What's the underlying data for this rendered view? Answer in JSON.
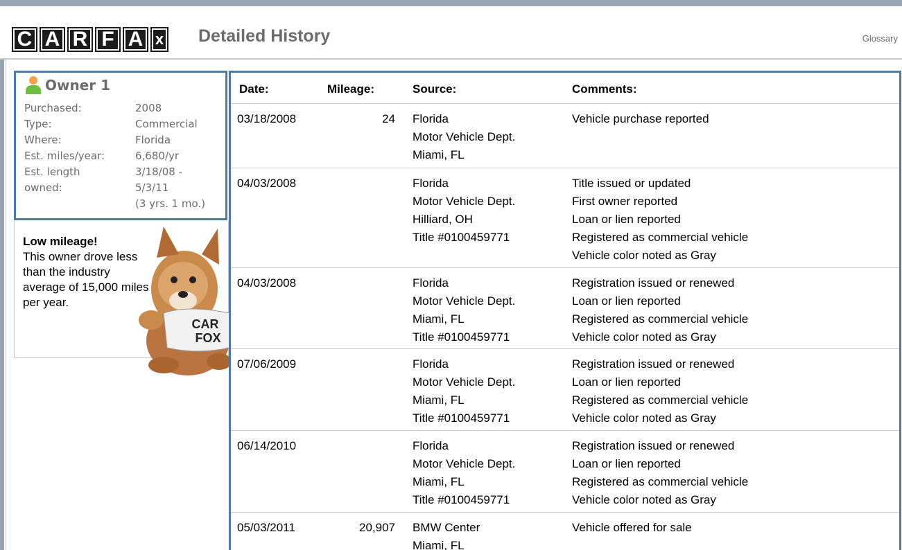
{
  "header": {
    "logo_letters": [
      "C",
      "A",
      "R",
      "F",
      "A",
      "x"
    ],
    "title": "Detailed History",
    "glossary_link": "Glossary"
  },
  "owner": {
    "title": "Owner 1",
    "icon": "person-icon",
    "details": [
      {
        "label": "Purchased:",
        "value": "2008"
      },
      {
        "label": "Type:",
        "value": "Commercial"
      },
      {
        "label": "Where:",
        "value": "Florida"
      },
      {
        "label": "Est. miles/year:",
        "value": "6,680/yr"
      }
    ],
    "length": {
      "label_lines": [
        "Est. length",
        "owned:"
      ],
      "value_lines": [
        "3/18/08 -",
        "5/3/11",
        "(3 yrs. 1 mo.)"
      ]
    },
    "note": {
      "heading": "Low mileage!",
      "text": "This owner drove less than the industry average of 15,000 miles per year."
    },
    "mascot_shirt_text": [
      "CAR",
      "FOX"
    ]
  },
  "table": {
    "headers": {
      "date": "Date:",
      "mileage": "Mileage:",
      "source": "Source:",
      "comments": "Comments:"
    },
    "rows": [
      {
        "date": "03/18/2008",
        "mileage": "24",
        "source": [
          "Florida",
          "Motor Vehicle Dept.",
          "Miami, FL"
        ],
        "comments": [
          "Vehicle purchase reported"
        ]
      },
      {
        "date": "04/03/2008",
        "mileage": "",
        "source": [
          "Florida",
          "Motor Vehicle Dept.",
          "Hilliard, OH",
          "Title #0100459771"
        ],
        "comments": [
          "Title issued or updated",
          "First owner reported",
          "Loan or lien reported",
          "Registered as commercial vehicle",
          "Vehicle color noted as Gray"
        ]
      },
      {
        "date": "04/03/2008",
        "mileage": "",
        "source": [
          "Florida",
          "Motor Vehicle Dept.",
          "Miami, FL",
          "Title #0100459771"
        ],
        "comments": [
          "Registration issued or renewed",
          "Loan or lien reported",
          "Registered as commercial vehicle",
          "Vehicle color noted as Gray"
        ]
      },
      {
        "date": "07/06/2009",
        "mileage": "",
        "source": [
          "Florida",
          "Motor Vehicle Dept.",
          "Miami, FL",
          "Title #0100459771"
        ],
        "comments": [
          "Registration issued or renewed",
          "Loan or lien reported",
          "Registered as commercial vehicle",
          "Vehicle color noted as Gray"
        ]
      },
      {
        "date": "06/14/2010",
        "mileage": "",
        "source": [
          "Florida",
          "Motor Vehicle Dept.",
          "Miami, FL",
          "Title #0100459771"
        ],
        "comments": [
          "Registration issued or renewed",
          "Loan or lien reported",
          "Registered as commercial vehicle",
          "Vehicle color noted as Gray"
        ]
      },
      {
        "date": "05/03/2011",
        "mileage": "20,907",
        "source": [
          "BMW Center",
          "Miami, FL"
        ],
        "comments": [
          "Vehicle offered for sale"
        ]
      }
    ]
  },
  "colors": {
    "accent_blue": "#4d79ab",
    "title_gray": "#6b6b6b",
    "frame_gray": "#9aa5b3"
  }
}
